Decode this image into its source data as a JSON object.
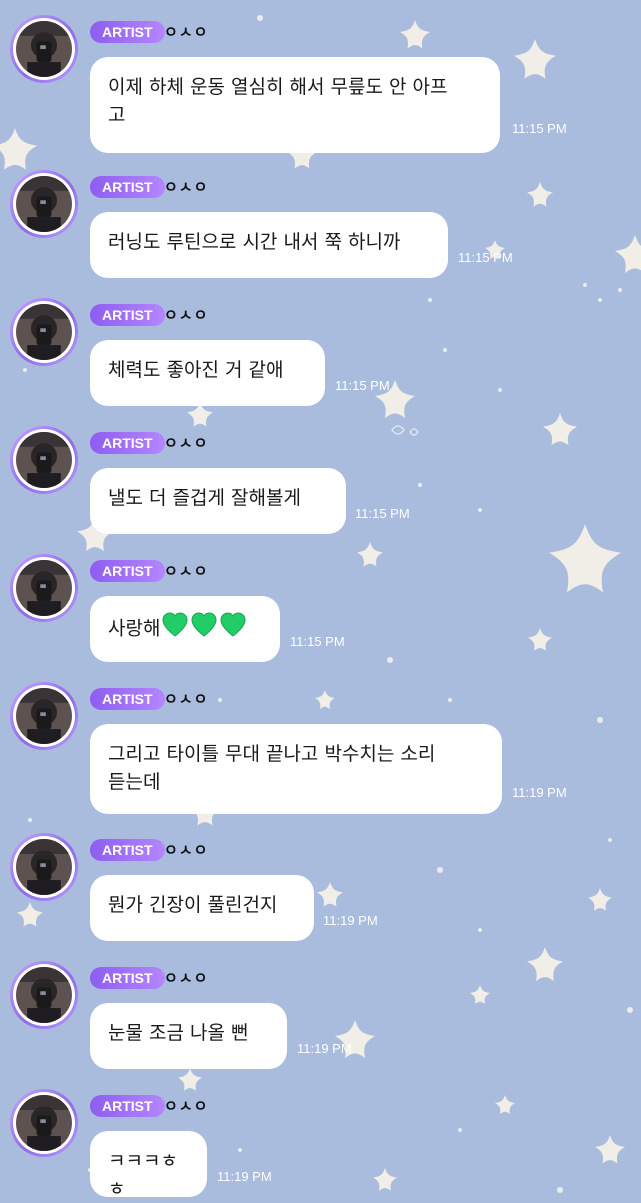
{
  "colors": {
    "background": "#a9bcdd",
    "badge_start": "#8e5df2",
    "badge_end": "#b586ff",
    "bubble": "#ffffff",
    "timestamp": "#ffffff",
    "heart": "#22cc66"
  },
  "messages": [
    {
      "badge": "ARTIST",
      "sender": "ㅇㅅㅇ",
      "lines": [
        "이제 하체 운동 열심히 해서 무릎도 안 아프",
        "고"
      ],
      "time": "11:15 PM"
    },
    {
      "badge": "ARTIST",
      "sender": "ㅇㅅㅇ",
      "lines": [
        "러닝도 루틴으로 시간 내서 쭉 하니까"
      ],
      "time": "11:15 PM"
    },
    {
      "badge": "ARTIST",
      "sender": "ㅇㅅㅇ",
      "lines": [
        "체력도 좋아진 거 같애"
      ],
      "time": "11:15 PM"
    },
    {
      "badge": "ARTIST",
      "sender": "ㅇㅅㅇ",
      "lines": [
        "낼도 더 즐겁게 잘해볼게"
      ],
      "time": "11:15 PM"
    },
    {
      "badge": "ARTIST",
      "sender": "ㅇㅅㅇ",
      "lines": [
        "사랑해"
      ],
      "emoji": "green-heart-icon x3",
      "time": "11:15 PM"
    },
    {
      "badge": "ARTIST",
      "sender": "ㅇㅅㅇ",
      "lines": [
        "그리고 타이틀 무대 끝나고 박수치는 소리",
        "듣는데"
      ],
      "time": "11:19 PM"
    },
    {
      "badge": "ARTIST",
      "sender": "ㅇㅅㅇ",
      "lines": [
        "뭔가 긴장이 풀린건지"
      ],
      "time": "11:19 PM"
    },
    {
      "badge": "ARTIST",
      "sender": "ㅇㅅㅇ",
      "lines": [
        "눈물 조금 나올 뻔"
      ],
      "time": "11:19 PM"
    },
    {
      "badge": "ARTIST",
      "sender": "ㅇㅅㅇ",
      "lines": [
        "ㅋㅋㅋㅎㅎ"
      ],
      "time": "11:19 PM"
    }
  ]
}
